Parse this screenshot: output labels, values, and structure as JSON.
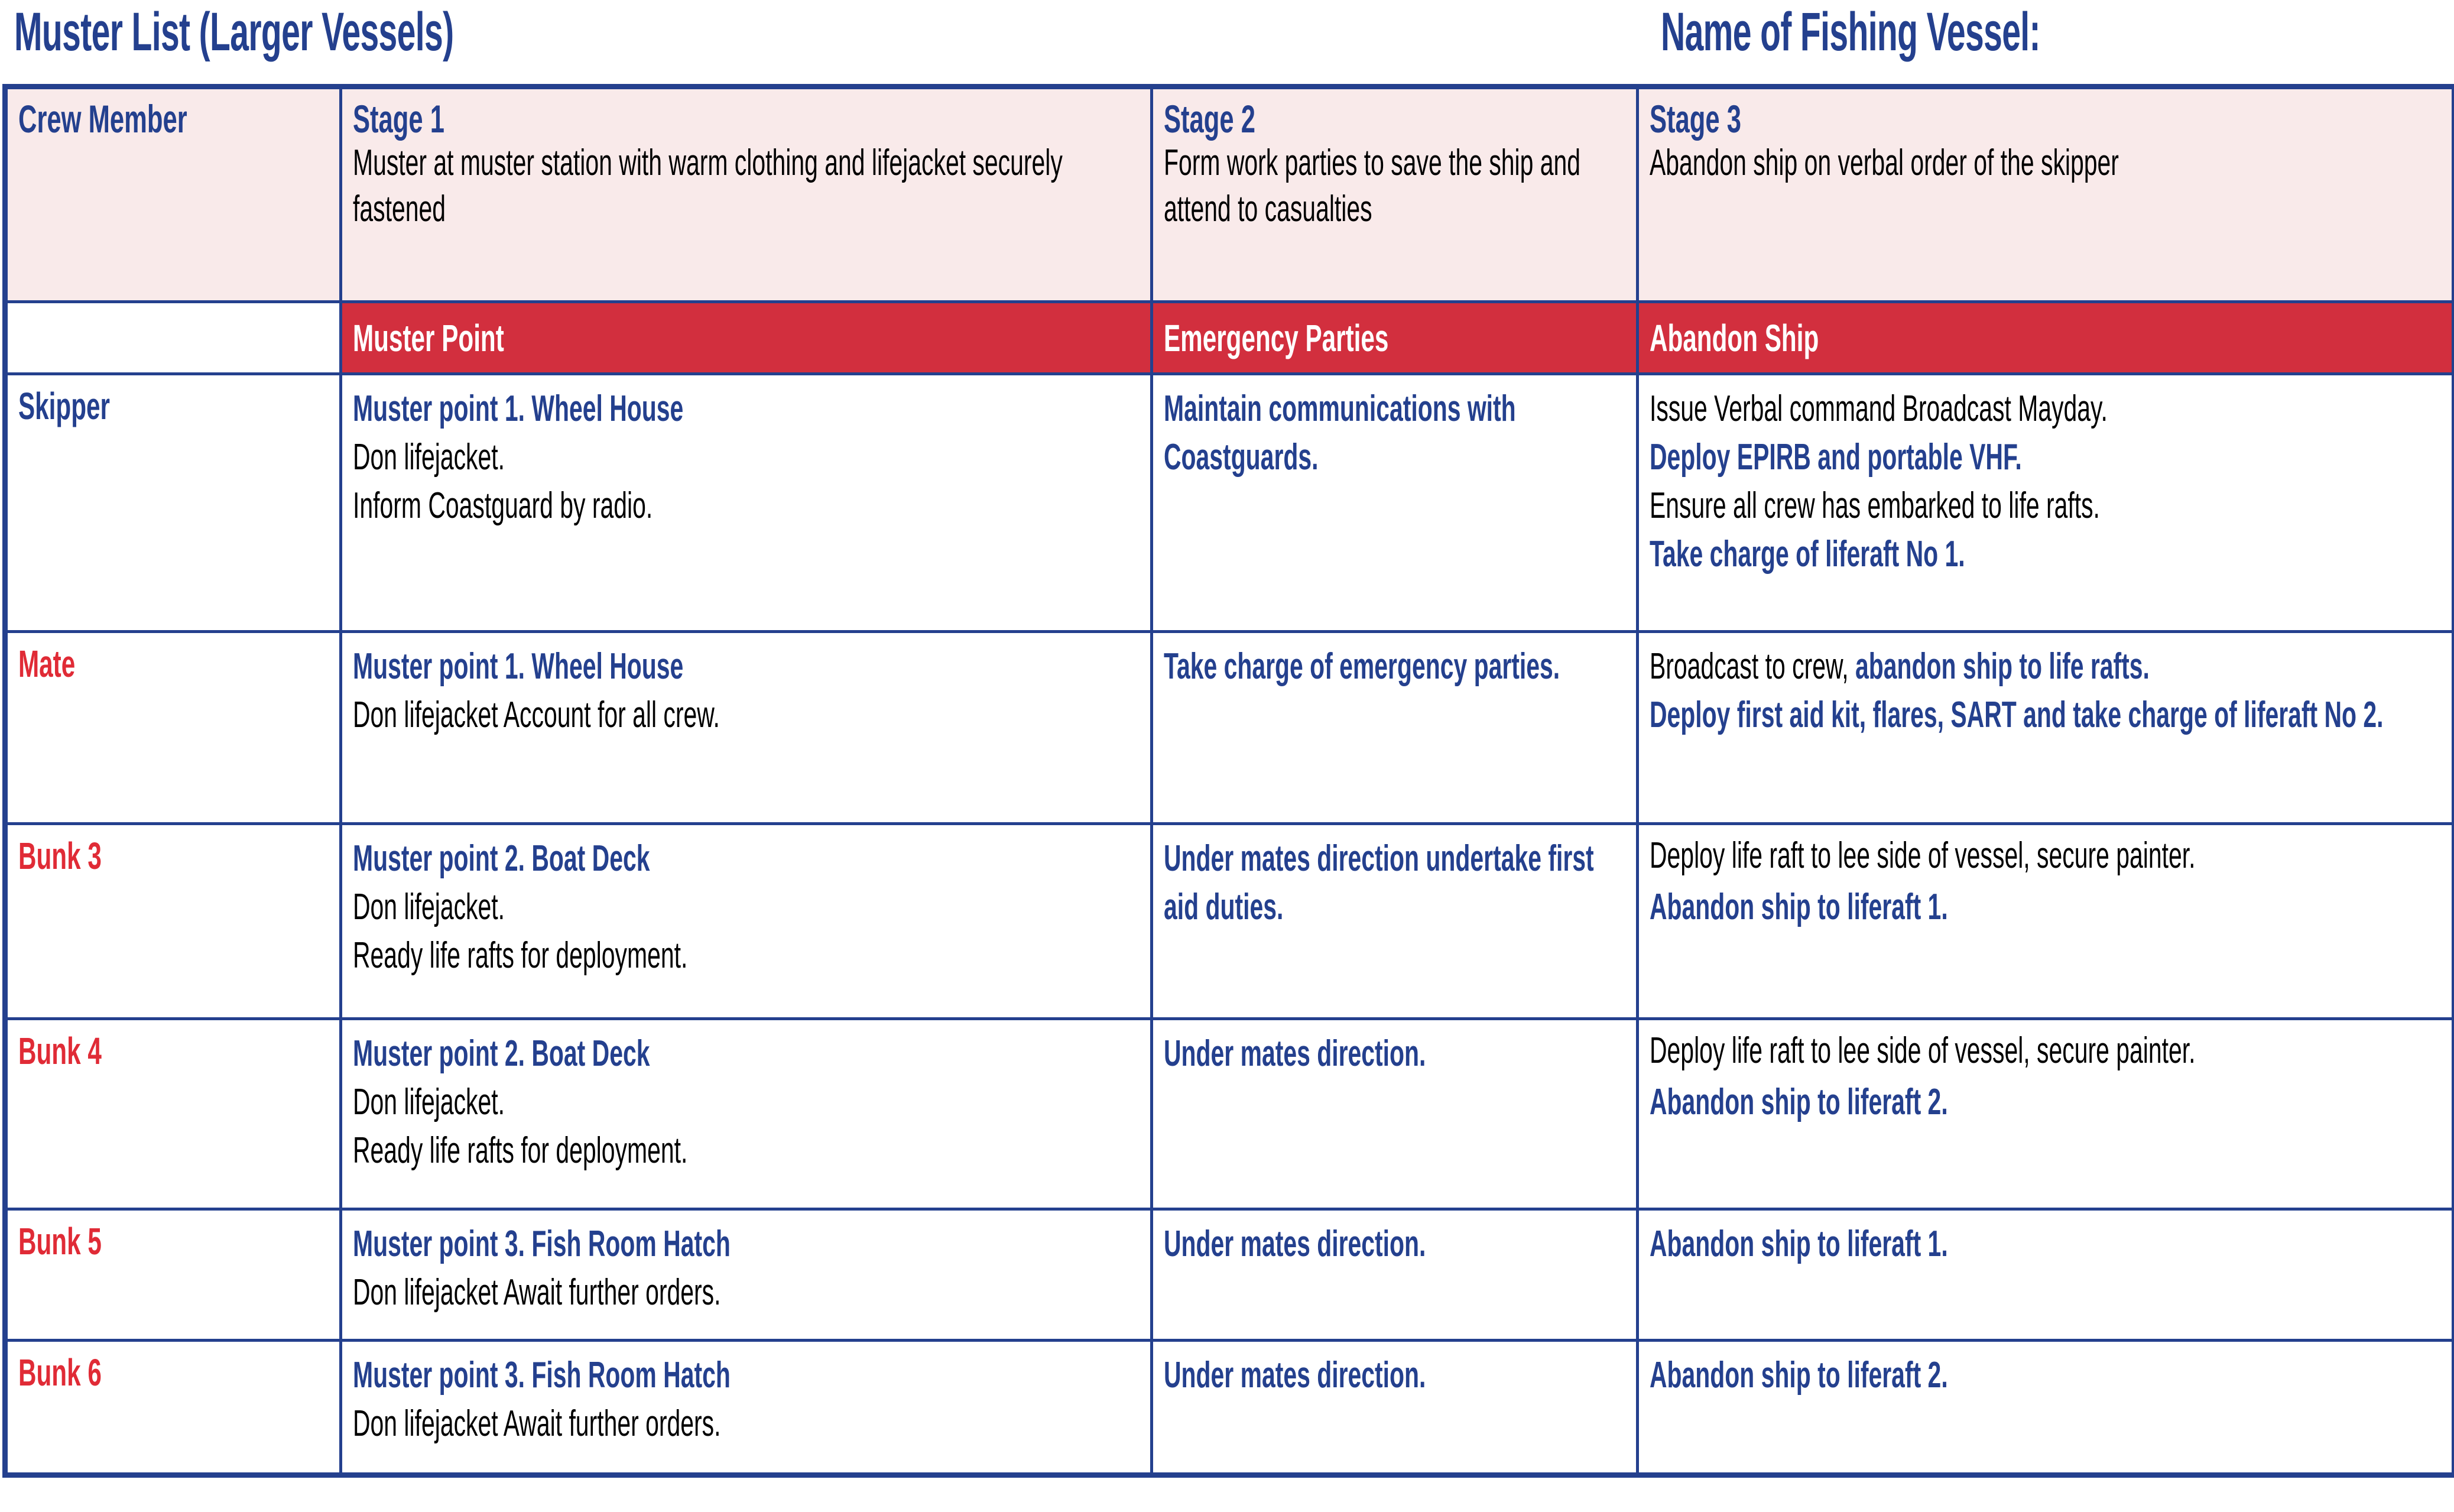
{
  "titles": {
    "left": "Muster List (Larger Vessels)",
    "right": "Name of Fishing Vessel:"
  },
  "colors": {
    "navy": "#24408E",
    "red": "#D22F3E",
    "crew_red": "#E02B36",
    "header_fill": "#F9EAEA",
    "white": "#FFFFFF"
  },
  "table": {
    "stage_header": {
      "crew_member": "Crew Member",
      "stages": [
        {
          "label": "Stage 1",
          "desc": "Muster at muster station with warm clothing and lifejacket securely fastened"
        },
        {
          "label": "Stage 2",
          "desc": "Form work parties to save the ship and attend to casualties"
        },
        {
          "label": "Stage 3",
          "desc": "Abandon ship on verbal order of the skipper"
        }
      ]
    },
    "banner": {
      "blank": "",
      "muster_point": "Muster Point",
      "emergency_parties": "Emergency Parties",
      "abandon_ship": "Abandon Ship"
    },
    "rows": [
      {
        "crew": "Skipper",
        "crew_color": "navy",
        "stage1": [
          {
            "text": "Muster point 1. Wheel House",
            "bold": true
          },
          {
            "text": "Don lifejacket.",
            "bold": false
          },
          {
            "text": "Inform Coastguard by radio.",
            "bold": false
          }
        ],
        "stage2": [
          {
            "text": "Maintain communications with Coastguards.",
            "bold": true
          }
        ],
        "stage3": [
          {
            "text": "Issue Verbal command Broadcast Mayday.",
            "bold": false
          },
          {
            "text": "Deploy EPIRB and portable VHF.",
            "bold": true
          },
          {
            "text": "Ensure all crew has embarked to life rafts.",
            "bold": false
          },
          {
            "text": "Take charge of liferaft No 1.",
            "bold": true
          }
        ]
      },
      {
        "crew": "Mate",
        "crew_color": "red",
        "stage1": [
          {
            "text": "Muster point 1. Wheel House",
            "bold": true
          },
          {
            "text": "Don lifejacket Account for all crew.",
            "bold": false
          }
        ],
        "stage2": [
          {
            "text": "Take charge of emergency parties.",
            "bold": true
          }
        ],
        "stage3": [
          {
            "plain": "Broadcast to crew, ",
            "emph": "abandon ship to life rafts."
          },
          {
            "text": "Deploy first aid kit, flares, SART and take charge of liferaft No 2.",
            "bold": true
          }
        ]
      },
      {
        "crew": "Bunk 3",
        "crew_color": "red",
        "stage1": [
          {
            "text": "Muster point 2. Boat Deck",
            "bold": true
          },
          {
            "text": "Don lifejacket.",
            "bold": false
          },
          {
            "text": "Ready life rafts for deployment.",
            "bold": false
          }
        ],
        "stage2": [
          {
            "text": "Under mates direction undertake first aid duties.",
            "bold": true
          }
        ],
        "stage3": [
          {
            "text": "Deploy life raft to lee side of vessel, secure painter.",
            "bold": false
          },
          {
            "text": "Abandon ship to liferaft 1.",
            "bold": true
          }
        ]
      },
      {
        "crew": "Bunk 4",
        "crew_color": "red",
        "stage1": [
          {
            "text": "Muster point 2. Boat Deck",
            "bold": true
          },
          {
            "text": "Don lifejacket.",
            "bold": false
          },
          {
            "text": "Ready life rafts for deployment.",
            "bold": false
          }
        ],
        "stage2": [
          {
            "text": "Under mates direction.",
            "bold": true
          }
        ],
        "stage3": [
          {
            "text": "Deploy life raft to lee side of vessel, secure painter.",
            "bold": false
          },
          {
            "text": "Abandon ship to liferaft 2.",
            "bold": true
          }
        ]
      },
      {
        "crew": "Bunk 5",
        "crew_color": "red",
        "stage1": [
          {
            "text": "Muster point 3. Fish Room Hatch",
            "bold": true
          },
          {
            "text": "Don lifejacket Await further orders.",
            "bold": false
          }
        ],
        "stage2": [
          {
            "text": "Under mates direction.",
            "bold": true
          }
        ],
        "stage3": [
          {
            "text": "Abandon ship to liferaft 1.",
            "bold": true
          }
        ]
      },
      {
        "crew": "Bunk 6",
        "crew_color": "red",
        "stage1": [
          {
            "text": "Muster point 3. Fish Room Hatch",
            "bold": true
          },
          {
            "text": "Don lifejacket Await further orders.",
            "bold": false
          }
        ],
        "stage2": [
          {
            "text": "Under mates direction.",
            "bold": true
          }
        ],
        "stage3": [
          {
            "text": "Abandon ship to liferaft 2.",
            "bold": true
          }
        ]
      }
    ]
  }
}
